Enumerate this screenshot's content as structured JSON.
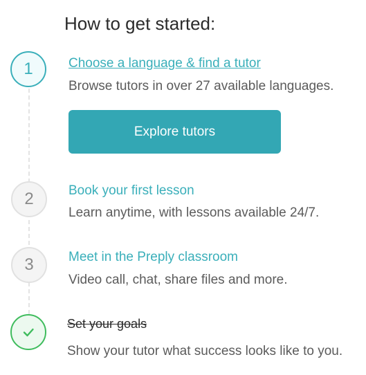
{
  "title": "How to get started:",
  "steps": [
    {
      "number": "1",
      "title": "Choose a language & find a tutor",
      "description": "Browse tutors in over 27 available languages."
    },
    {
      "number": "2",
      "title": "Book your first lesson",
      "description": "Learn anytime, with lessons available 24/7."
    },
    {
      "number": "3",
      "title": "Meet in the Preply classroom",
      "description": "Video call, chat, share files and more."
    },
    {
      "title": "Set your goals",
      "description": "Show your tutor what success looks like to you.",
      "completed_icon": "checkmark-icon"
    }
  ],
  "cta": {
    "label": "Explore tutors"
  },
  "colors": {
    "accent": "#3aafba",
    "button": "#33a7b4",
    "success": "#3fbc5d",
    "inactive": "#8a8a8a"
  }
}
